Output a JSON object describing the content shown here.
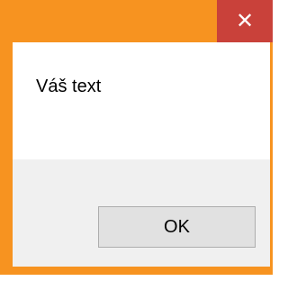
{
  "dialog": {
    "close_glyph": "✕",
    "message": "Váš text",
    "ok_label": "OK"
  },
  "colors": {
    "frame": "#f79320",
    "close_button": "#c9413a",
    "message_area": "#ffffff",
    "button_area": "#f0f0f0",
    "ok_button": "#e1e1e1"
  },
  "icons": {
    "close": "close-icon"
  }
}
